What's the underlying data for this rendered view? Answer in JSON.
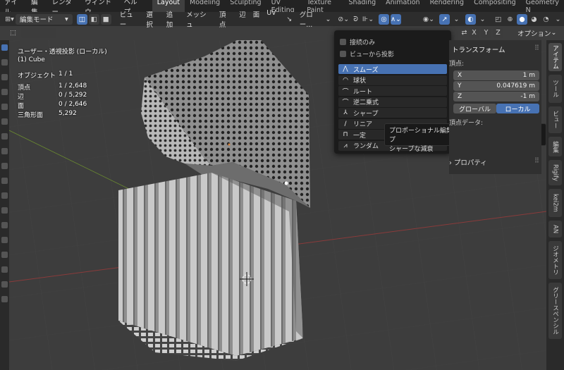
{
  "topbar": {
    "menus": [
      "ァイル",
      "編集",
      "レンダー",
      "ウィンドウ",
      "ヘルプ"
    ],
    "tabs": [
      "Layout",
      "Modeling",
      "Sculpting",
      "UV Editing",
      "Texture Paint",
      "Shading",
      "Animation",
      "Rendering",
      "Compositing",
      "Geometry N"
    ]
  },
  "header": {
    "mode": "編集モード",
    "menus": [
      "ビュー",
      "選択",
      "追加",
      "メッシュ",
      "頂点",
      "辺",
      "面",
      "UV"
    ],
    "transform_orientation": "グロー...",
    "axes": [
      "X",
      "Y",
      "Z"
    ],
    "options": "オプション"
  },
  "viewport": {
    "view_title": "ユーザー・透視投影 (ローカル)",
    "object_line": "(1) Cube",
    "stats": [
      {
        "label": "オブジェクト",
        "value": "1 / 1"
      },
      {
        "label": "頂点",
        "value": "1 / 2,648"
      },
      {
        "label": "辺",
        "value": "0 / 5,292"
      },
      {
        "label": "面",
        "value": "0 / 2,646"
      },
      {
        "label": "三角形面",
        "value": "5,292"
      }
    ]
  },
  "proportional_popup": {
    "checks": [
      "接続のみ",
      "ビューから投影"
    ],
    "options": [
      {
        "label": "スムーズ",
        "icon": "smooth-falloff-icon",
        "selected": true
      },
      {
        "label": "球状",
        "icon": "sphere-falloff-icon",
        "selected": false
      },
      {
        "label": "ルート",
        "icon": "root-falloff-icon",
        "selected": false
      },
      {
        "label": "逆二乗式",
        "icon": "inverse-square-falloff-icon",
        "selected": false
      },
      {
        "label": "シャープ",
        "icon": "sharp-falloff-icon",
        "selected": false
      },
      {
        "label": "リニア",
        "icon": "linear-falloff-icon",
        "selected": false
      },
      {
        "label": "一定",
        "icon": "constant-falloff-icon",
        "selected": false
      },
      {
        "label": "ランダム",
        "icon": "random-falloff-icon",
        "selected": false
      }
    ]
  },
  "tooltip": {
    "line1": "プロポーショナル編集で使われる減衰タイプ: シャープ",
    "line2": "シャープな減衰"
  },
  "npanel": {
    "transform_header": "トランスフォーム",
    "vertex_label": "頂点:",
    "x_label": "X",
    "x_value": "1 m",
    "y_label": "Y",
    "y_value": "0.047619 m",
    "z_label": "Z",
    "z_value": "-1 m",
    "global": "グローバル",
    "local": "ローカル",
    "vertex_data": "頂点データ:",
    "properties": "プロパティ"
  },
  "side_tabs": [
    "アイテム",
    "ツール",
    "ビュー",
    "編集",
    "Rigify",
    "kei2m",
    "AN",
    "ジオメトリ",
    "グリースペンシル"
  ],
  "colors": {
    "accent": "#4772b3",
    "grid_red": "#8a3b3b",
    "grid_green": "#6a8a30"
  }
}
